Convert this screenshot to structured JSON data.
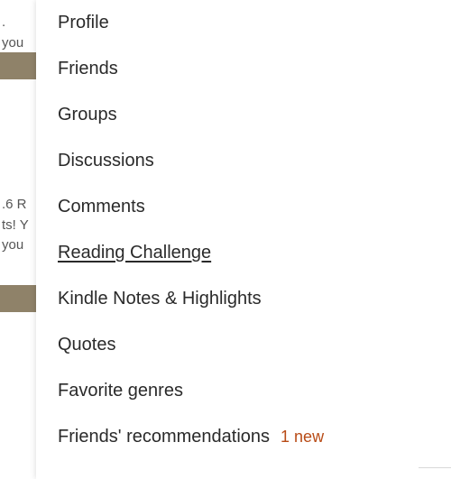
{
  "background": {
    "fragment1_line1": ".",
    "fragment1_line2": "you",
    "fragment2_line1": ".6 R",
    "fragment2_line2": "ts! Y",
    "fragment2_line3": "you"
  },
  "menu": {
    "items": [
      {
        "label": "Profile",
        "underlined": false,
        "badge": ""
      },
      {
        "label": "Friends",
        "underlined": false,
        "badge": ""
      },
      {
        "label": "Groups",
        "underlined": false,
        "badge": ""
      },
      {
        "label": "Discussions",
        "underlined": false,
        "badge": ""
      },
      {
        "label": "Comments",
        "underlined": false,
        "badge": ""
      },
      {
        "label": "Reading Challenge",
        "underlined": true,
        "badge": ""
      },
      {
        "label": "Kindle Notes & Highlights",
        "underlined": false,
        "badge": ""
      },
      {
        "label": "Quotes",
        "underlined": false,
        "badge": ""
      },
      {
        "label": "Favorite genres",
        "underlined": false,
        "badge": ""
      },
      {
        "label": "Friends' recommendations",
        "underlined": false,
        "badge": "1 new"
      }
    ]
  }
}
